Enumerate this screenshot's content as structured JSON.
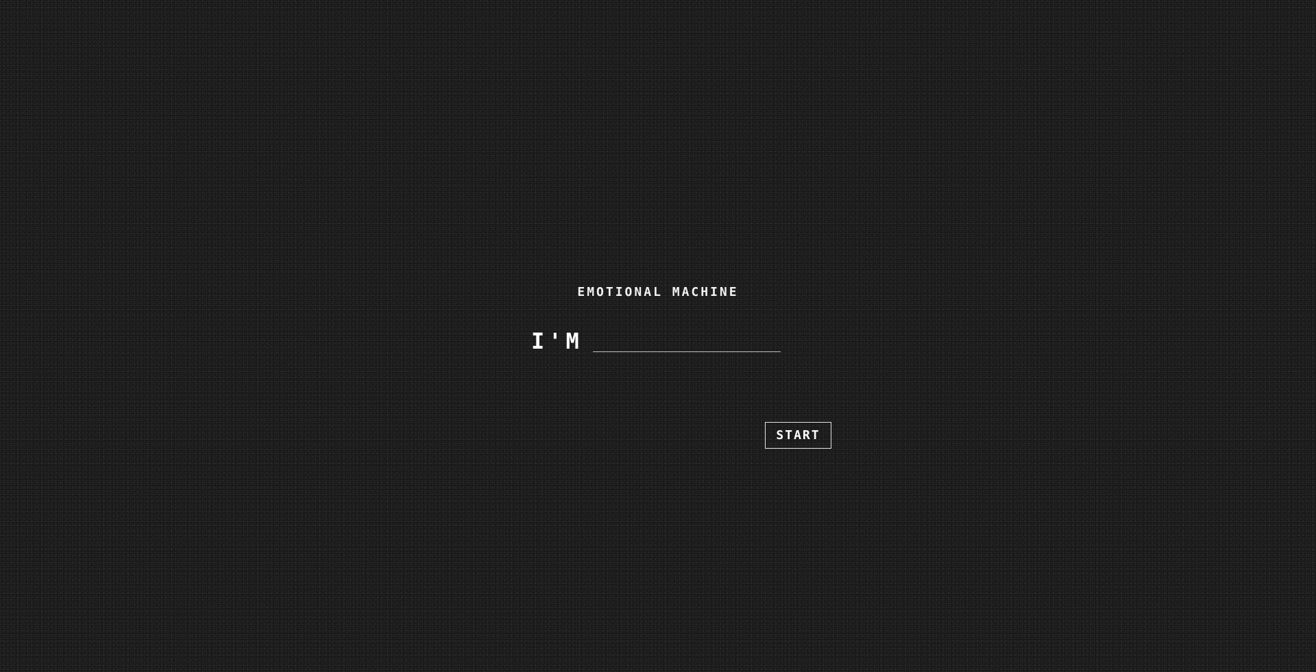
{
  "app": {
    "title": "EMOTIONAL MACHINE"
  },
  "prompt": {
    "label": "I'M",
    "value": "",
    "placeholder": ""
  },
  "actions": {
    "start_label": "START"
  },
  "colors": {
    "background": "#0c0c0c",
    "text": "#ffffff",
    "underline": "#bdbdbd",
    "button_border": "#e6e6e6"
  }
}
